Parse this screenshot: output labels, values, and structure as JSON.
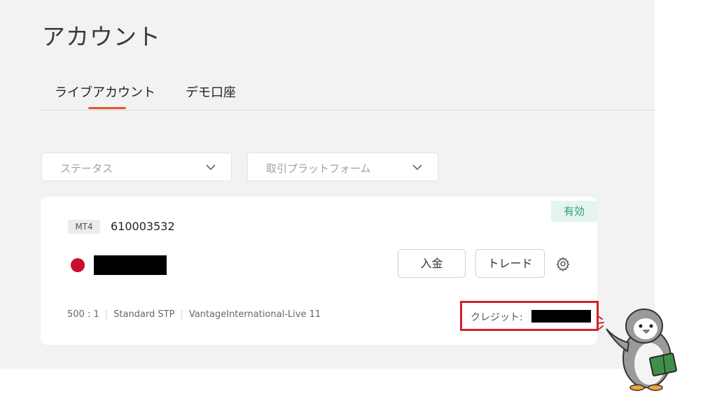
{
  "page": {
    "title": "アカウント"
  },
  "tabs": [
    {
      "label": "ライブアカウント",
      "active": true
    },
    {
      "label": "デモ口座",
      "active": false
    }
  ],
  "filters": {
    "status_placeholder": "ステータス",
    "platform_placeholder": "取引プラットフォーム"
  },
  "account": {
    "status": "有効",
    "platform": "MT4",
    "number": "610003532",
    "deposit_label": "入金",
    "trade_label": "トレード",
    "leverage": "500 : 1",
    "type": "Standard STP",
    "server": "VantageInternational-Live 11",
    "credit_label": "クレジット:"
  },
  "colors": {
    "accent": "#e8562a",
    "status_text": "#2ba07e",
    "status_bg": "#e4f4ef",
    "highlight_border": "#d4202a"
  },
  "icons": [
    "chevron-down-icon",
    "gear-icon",
    "flag-icon",
    "penguin-mascot"
  ]
}
